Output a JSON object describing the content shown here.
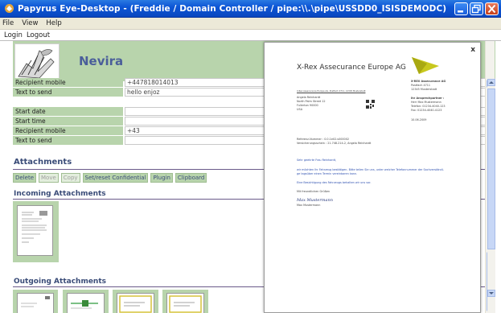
{
  "window": {
    "title": "Papyrus Eye-Desktop - (Freddie / Domain Controller / pipe:\\\\.\\pipe\\USSDD0_ISISDEMODC)"
  },
  "menu": {
    "items": [
      "File",
      "View",
      "Help"
    ]
  },
  "links": {
    "login": "Login",
    "logout": "Logout"
  },
  "header": {
    "brand": "Nevira"
  },
  "form1": {
    "recipient_mobile_label": "Recipient mobile",
    "recipient_mobile_value": "+447818014013",
    "text_to_send_label": "Text to send",
    "text_to_send_value": "hello enjoz"
  },
  "form2": {
    "start_date_label": "Start date",
    "start_date_value": "",
    "start_time_label": "Start time",
    "start_time_value": "",
    "recipient_mobile_label": "Recipient mobile",
    "recipient_mobile_value": "+43",
    "text_to_send_label": "Text to send",
    "text_to_send_value": ""
  },
  "attachments": {
    "title": "Attachments",
    "buttons": {
      "delete": "Delete",
      "move": "Move",
      "copy": "Copy",
      "confidential": "Set/reset Confidential",
      "plugin": "Plugin",
      "clipboard": "Clipboard"
    },
    "incoming_title": "Incoming Attachments",
    "outgoing_title": "Outgoing Attachments"
  },
  "preview": {
    "close": "x",
    "company": "X-Rex Assecurance Europe AG",
    "sender_line": "X-Rex Assecurance Europe AG, Postfach 4711, 12345 Musterstadt",
    "recipient": [
      "Angela Reinhardt",
      "North Palm Street 12",
      "Fullerton 90000",
      "USA"
    ],
    "company_block": [
      "X-REX Assecurance AG",
      "Postfach 4711",
      "12345 Musterstadt"
    ],
    "contact_label": "Ihr Ansprechpartner :",
    "contact_block": [
      "Herr Max Mustermann",
      "Telefon: 01234-4040-123",
      "Fax: 01234-4040-4123"
    ],
    "date": "10.06.2009",
    "ref_lines": [
      "Referenz-Nummer : 0.0.1e02.s000002",
      "Versicherungsschein : 21.748.214-2, Angela Reinhardt"
    ],
    "salutation": "Sehr geehrte Frau Reinhardt,",
    "body": [
      "wir möchten Ihr Fahrzeug bestätigen. Bitte teilen Sie uns, unter welcher Telefonnummer der Sachverständi-",
      "ge tagsüber einen Termin vereinbaren kann."
    ],
    "body2": "Eine Besichtigung des Fahrzeugs behalten wir uns vor.",
    "closing": "Mit freundlichen Grüßen",
    "signature": "Max Mustermann",
    "signer": "Max Mustermann"
  },
  "colors": {
    "titlebar": "#0d56d6",
    "panel_green": "#b8d4ac",
    "heading": "#3a4c78",
    "logo_yellow": "#c8c81e"
  },
  "icons": [
    "app-icon",
    "minimize-icon",
    "maximize-icon",
    "close-icon",
    "logo-image",
    "scroll-up-icon",
    "scroll-down-icon"
  ]
}
